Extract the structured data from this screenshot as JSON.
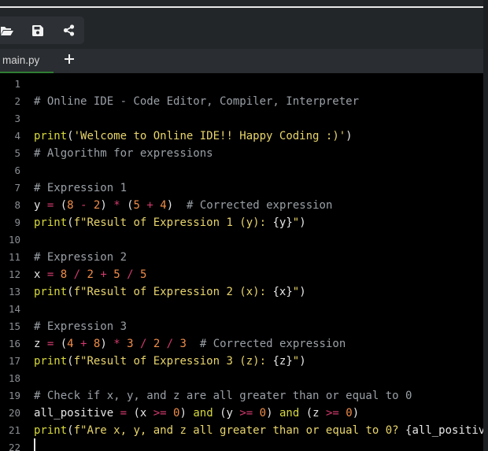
{
  "toolbar": {
    "icons": [
      "folder-open-icon",
      "save-icon",
      "share-icon"
    ]
  },
  "tabs": [
    {
      "label": "main.py",
      "active": true
    }
  ],
  "editor": {
    "line_numbers": [
      "1",
      "2",
      "3",
      "4",
      "5",
      "6",
      "7",
      "8",
      "9",
      "10",
      "11",
      "12",
      "13",
      "14",
      "15",
      "16",
      "17",
      "18",
      "19",
      "20",
      "21",
      "22"
    ],
    "lines": [
      [],
      [
        {
          "t": "# Online IDE - Code Editor, Compiler, Interpreter",
          "c": "c"
        }
      ],
      [],
      [
        {
          "t": "print",
          "c": "k"
        },
        {
          "t": "(",
          "c": "p"
        },
        {
          "t": "'Welcome to Online IDE!! Happy Coding :)'",
          "c": "s"
        },
        {
          "t": ")",
          "c": "p"
        }
      ],
      [
        {
          "t": "# Algorithm for expressions",
          "c": "c"
        }
      ],
      [],
      [
        {
          "t": "# Expression 1",
          "c": "c"
        }
      ],
      [
        {
          "t": "y",
          "c": "v"
        },
        {
          "t": " = ",
          "c": "o"
        },
        {
          "t": "(",
          "c": "p"
        },
        {
          "t": "8",
          "c": "n"
        },
        {
          "t": " - ",
          "c": "o"
        },
        {
          "t": "2",
          "c": "n"
        },
        {
          "t": ")",
          "c": "p"
        },
        {
          "t": " * ",
          "c": "o"
        },
        {
          "t": "(",
          "c": "p"
        },
        {
          "t": "5",
          "c": "n"
        },
        {
          "t": " + ",
          "c": "o"
        },
        {
          "t": "4",
          "c": "n"
        },
        {
          "t": ")",
          "c": "p"
        },
        {
          "t": "  # Corrected expression",
          "c": "c"
        }
      ],
      [
        {
          "t": "print",
          "c": "k"
        },
        {
          "t": "(",
          "c": "p"
        },
        {
          "t": "f\"Result of Expression 1 (y): ",
          "c": "s"
        },
        {
          "t": "{y}",
          "c": "p"
        },
        {
          "t": "\"",
          "c": "s"
        },
        {
          "t": ")",
          "c": "p"
        }
      ],
      [],
      [
        {
          "t": "# Expression 2",
          "c": "c"
        }
      ],
      [
        {
          "t": "x",
          "c": "v"
        },
        {
          "t": " = ",
          "c": "o"
        },
        {
          "t": "8",
          "c": "n"
        },
        {
          "t": " / ",
          "c": "o"
        },
        {
          "t": "2",
          "c": "n"
        },
        {
          "t": " + ",
          "c": "o"
        },
        {
          "t": "5",
          "c": "n"
        },
        {
          "t": " / ",
          "c": "o"
        },
        {
          "t": "5",
          "c": "n"
        }
      ],
      [
        {
          "t": "print",
          "c": "k"
        },
        {
          "t": "(",
          "c": "p"
        },
        {
          "t": "f\"Result of Expression 2 (x): ",
          "c": "s"
        },
        {
          "t": "{x}",
          "c": "p"
        },
        {
          "t": "\"",
          "c": "s"
        },
        {
          "t": ")",
          "c": "p"
        }
      ],
      [],
      [
        {
          "t": "# Expression 3",
          "c": "c"
        }
      ],
      [
        {
          "t": "z",
          "c": "v"
        },
        {
          "t": " = ",
          "c": "o"
        },
        {
          "t": "(",
          "c": "p"
        },
        {
          "t": "4",
          "c": "n"
        },
        {
          "t": " + ",
          "c": "o"
        },
        {
          "t": "8",
          "c": "n"
        },
        {
          "t": ")",
          "c": "p"
        },
        {
          "t": " * ",
          "c": "o"
        },
        {
          "t": "3",
          "c": "n"
        },
        {
          "t": " / ",
          "c": "o"
        },
        {
          "t": "2",
          "c": "n"
        },
        {
          "t": " / ",
          "c": "o"
        },
        {
          "t": "3",
          "c": "n"
        },
        {
          "t": "  # Corrected expression",
          "c": "c"
        }
      ],
      [
        {
          "t": "print",
          "c": "k"
        },
        {
          "t": "(",
          "c": "p"
        },
        {
          "t": "f\"Result of Expression 3 (z): ",
          "c": "s"
        },
        {
          "t": "{z}",
          "c": "p"
        },
        {
          "t": "\"",
          "c": "s"
        },
        {
          "t": ")",
          "c": "p"
        }
      ],
      [],
      [
        {
          "t": "# Check if x, y, and z are all greater than or equal to 0",
          "c": "c"
        }
      ],
      [
        {
          "t": "all_positive",
          "c": "v"
        },
        {
          "t": " = ",
          "c": "o"
        },
        {
          "t": "(",
          "c": "p"
        },
        {
          "t": "x",
          "c": "v"
        },
        {
          "t": " >= ",
          "c": "o"
        },
        {
          "t": "0",
          "c": "n"
        },
        {
          "t": ")",
          "c": "p"
        },
        {
          "t": " and ",
          "c": "w"
        },
        {
          "t": "(",
          "c": "p"
        },
        {
          "t": "y",
          "c": "v"
        },
        {
          "t": " >= ",
          "c": "o"
        },
        {
          "t": "0",
          "c": "n"
        },
        {
          "t": ")",
          "c": "p"
        },
        {
          "t": " and ",
          "c": "w"
        },
        {
          "t": "(",
          "c": "p"
        },
        {
          "t": "z",
          "c": "v"
        },
        {
          "t": " >= ",
          "c": "o"
        },
        {
          "t": "0",
          "c": "n"
        },
        {
          "t": ")",
          "c": "p"
        }
      ],
      [
        {
          "t": "print",
          "c": "k"
        },
        {
          "t": "(",
          "c": "p"
        },
        {
          "t": "f\"Are x, y, and z all greater than or equal to 0? ",
          "c": "s"
        },
        {
          "t": "{all_positive}",
          "c": "p"
        }
      ],
      []
    ]
  },
  "colors": {
    "background": "#232629",
    "editor_background": "#000000",
    "active_tab_underline": "#2e7d32",
    "comment": "#9aa0a6",
    "keyword": "#d7d93c",
    "string": "#e8d56b",
    "number": "#f08d49",
    "operator": "#d23a6d"
  }
}
